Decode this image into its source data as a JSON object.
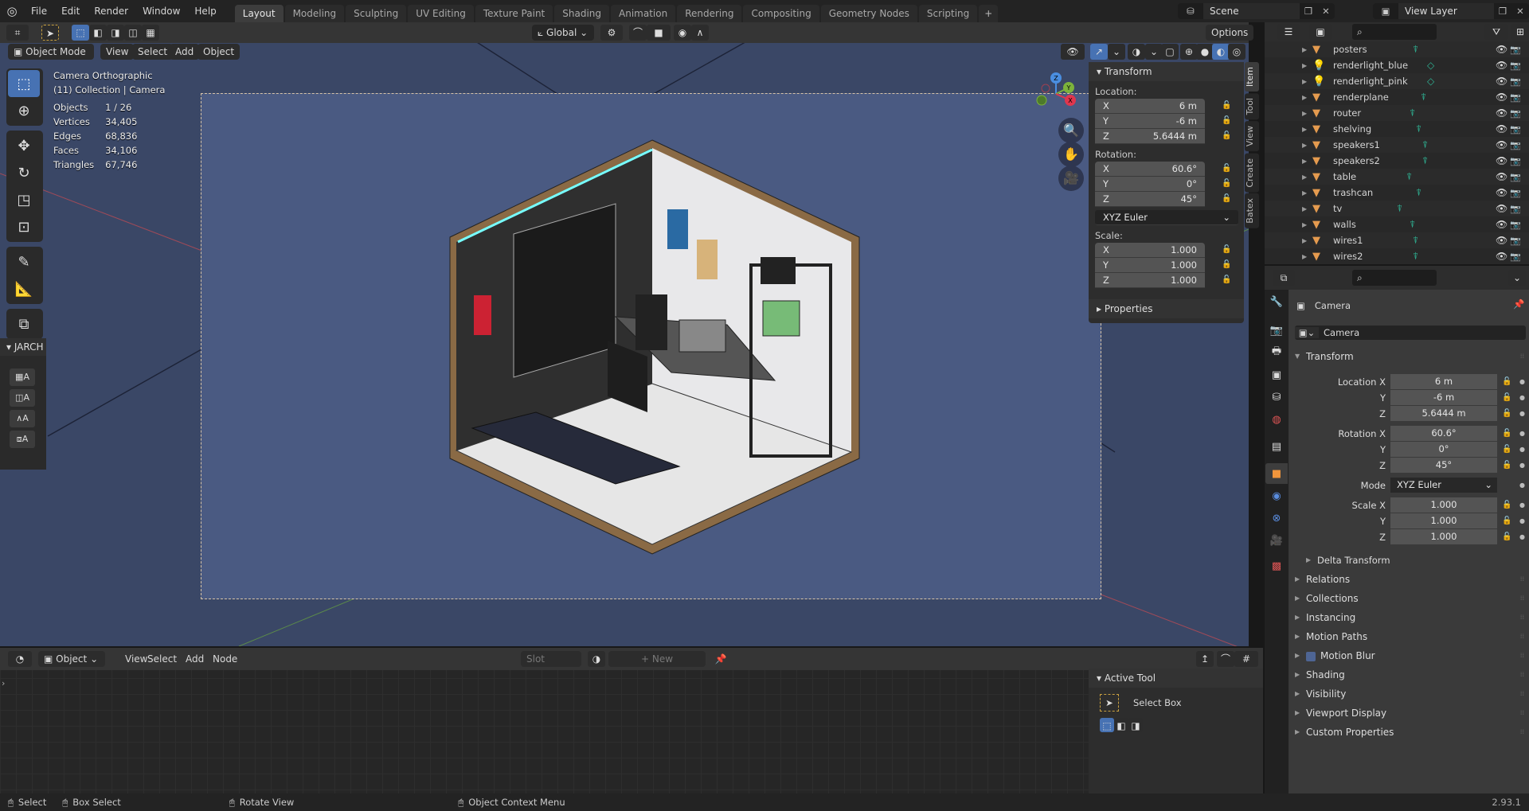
{
  "topbar": {
    "menus": [
      "File",
      "Edit",
      "Render",
      "Window",
      "Help"
    ],
    "workspaces": [
      "Layout",
      "Modeling",
      "Sculpting",
      "UV Editing",
      "Texture Paint",
      "Shading",
      "Animation",
      "Rendering",
      "Compositing",
      "Geometry Nodes",
      "Scripting"
    ],
    "active_workspace": "Layout",
    "add_workspace": "+",
    "scene": "Scene",
    "view_layer": "View Layer"
  },
  "viewport": {
    "mode": "Object Mode",
    "menus": [
      "View",
      "Select",
      "Add",
      "Object"
    ],
    "transform_orientation": "Global",
    "options": "Options",
    "overlay_title": "Camera Orthographic",
    "overlay_collection": "(11) Collection | Camera",
    "stats": [
      {
        "label": "Objects",
        "value": "1 / 26"
      },
      {
        "label": "Vertices",
        "value": "34,405"
      },
      {
        "label": "Edges",
        "value": "68,836"
      },
      {
        "label": "Faces",
        "value": "34,106"
      },
      {
        "label": "Triangles",
        "value": "67,746"
      }
    ],
    "gizmo_axes": [
      "X",
      "Y",
      "Z"
    ],
    "jarch": {
      "title": "JARCH",
      "buttons": [
        "A",
        "A",
        "A",
        "A"
      ]
    },
    "side_tabs": [
      "Item",
      "Tool",
      "View",
      "Create",
      "Batex"
    ],
    "npanel": {
      "title": "Transform",
      "location_label": "Location:",
      "location": [
        {
          "axis": "X",
          "value": "6 m"
        },
        {
          "axis": "Y",
          "value": "-6 m"
        },
        {
          "axis": "Z",
          "value": "5.6444 m"
        }
      ],
      "rotation_label": "Rotation:",
      "rotation": [
        {
          "axis": "X",
          "value": "60.6°"
        },
        {
          "axis": "Y",
          "value": "0°"
        },
        {
          "axis": "Z",
          "value": "45°"
        }
      ],
      "rotation_mode": "XYZ Euler",
      "scale_label": "Scale:",
      "scale": [
        {
          "axis": "X",
          "value": "1.000"
        },
        {
          "axis": "Y",
          "value": "1.000"
        },
        {
          "axis": "Z",
          "value": "1.000"
        }
      ],
      "properties": "Properties"
    }
  },
  "shader_editor": {
    "type": "Object",
    "menus": [
      "View",
      "Select",
      "Add",
      "Node"
    ],
    "slot": "Slot",
    "new": "New",
    "active_tool_title": "Active Tool",
    "active_tool_name": "Select Box"
  },
  "outliner": {
    "items": [
      {
        "name": "posters",
        "type": "mesh"
      },
      {
        "name": "renderlight_blue",
        "type": "light"
      },
      {
        "name": "renderlight_pink",
        "type": "light"
      },
      {
        "name": "renderplane",
        "type": "mesh"
      },
      {
        "name": "router",
        "type": "mesh"
      },
      {
        "name": "shelving",
        "type": "mesh"
      },
      {
        "name": "speakers1",
        "type": "mesh"
      },
      {
        "name": "speakers2",
        "type": "mesh"
      },
      {
        "name": "table",
        "type": "mesh"
      },
      {
        "name": "trashcan",
        "type": "mesh"
      },
      {
        "name": "tv",
        "type": "mesh"
      },
      {
        "name": "walls",
        "type": "mesh"
      },
      {
        "name": "wires1",
        "type": "mesh"
      },
      {
        "name": "wires2",
        "type": "mesh"
      }
    ]
  },
  "properties": {
    "object_name": "Camera",
    "datablock": "Camera",
    "transform_title": "Transform",
    "location_x_label": "Location X",
    "rotation_x_label": "Rotation X",
    "mode_label": "Mode",
    "scale_x_label": "Scale X",
    "y_label": "Y",
    "z_label": "Z",
    "location": [
      "6 m",
      "-6 m",
      "5.6444 m"
    ],
    "rotation": [
      "60.6°",
      "0°",
      "45°"
    ],
    "mode": "XYZ Euler",
    "scale": [
      "1.000",
      "1.000",
      "1.000"
    ],
    "delta_transform": "Delta Transform",
    "sections": [
      "Relations",
      "Collections",
      "Instancing",
      "Motion Paths",
      "Motion Blur",
      "Shading",
      "Visibility",
      "Viewport Display",
      "Custom Properties"
    ],
    "motion_blur_checked": true
  },
  "statusbar": {
    "select": "Select",
    "box_select": "Box Select",
    "rotate_view": "Rotate View",
    "context_menu": "Object Context Menu",
    "version": "2.93.1"
  },
  "colors": {
    "accent": "#4772b3",
    "viewport_bg": "#3a4766",
    "camera_bg": "#4a5a82",
    "object_orange": "#e59b4f",
    "data_green": "#2fb495"
  }
}
